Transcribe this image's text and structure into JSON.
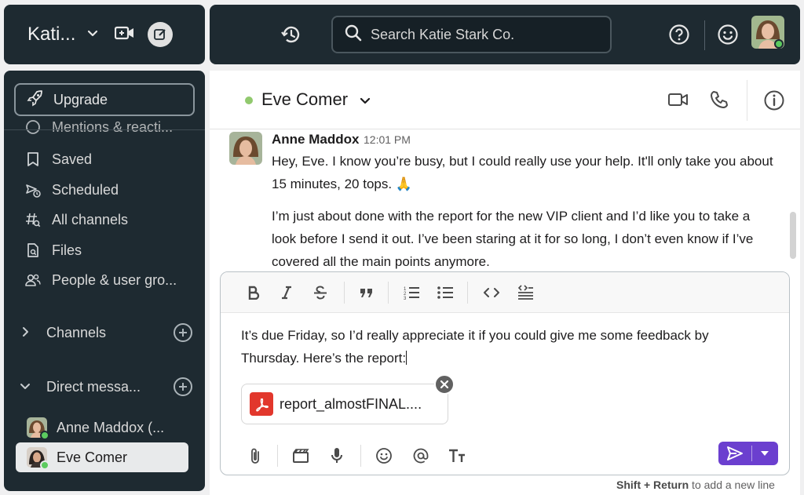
{
  "workspace": {
    "name": "Kati..."
  },
  "top": {
    "search_placeholder": "Search Katie Stark Co."
  },
  "sidebar": {
    "upgrade_label": "Upgrade",
    "mentions_label": "Mentions & reacti...",
    "items": [
      {
        "label": "Saved",
        "icon": "bookmark-icon"
      },
      {
        "label": "Scheduled",
        "icon": "scheduled-send-icon"
      },
      {
        "label": "All channels",
        "icon": "channels-search-icon"
      },
      {
        "label": "Files",
        "icon": "files-icon"
      },
      {
        "label": "People & user gro...",
        "icon": "people-icon"
      }
    ],
    "channels_label": "Channels",
    "dm_label": "Direct messa...",
    "dms": [
      {
        "label": "Anne Maddox (..."
      },
      {
        "label": "Eve Comer"
      }
    ]
  },
  "chat": {
    "title": "Eve Comer",
    "status_color": "#91c96e",
    "message": {
      "author": "Anne Maddox",
      "time": "12:01 PM",
      "p1": "Hey, Eve. I know you’re busy, but I could really use your help. It'll only take you about 15 minutes, 20 tops. 🙏",
      "p2": "I’m just about done with the report for the new VIP client and I’d like you to take a look before I send it out. I’ve been staring at it for so long, I don’t even know if I’ve covered all the main points anymore."
    }
  },
  "composer": {
    "draft": "It’s due Friday, so I’d really appreciate it if you could give me some feedback by Thursday. Here’s the report:",
    "attachment_name": "report_almostFINAL....",
    "hint_keys": "Shift + Return",
    "hint_text": " to add a new line",
    "send_color": "#6b3fcf"
  }
}
